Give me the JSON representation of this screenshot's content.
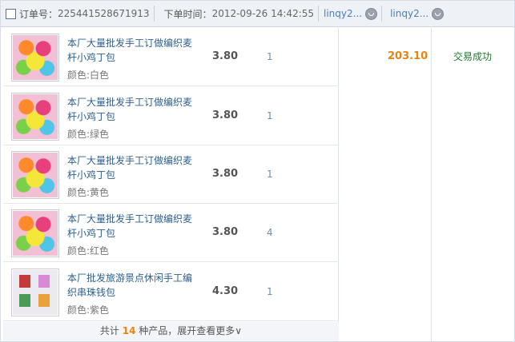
{
  "header": {
    "order_label": "订单号：",
    "order_no": "225441528671913",
    "time_label": "下单时间：",
    "time_value": "2012-09-26 14:42:55",
    "buyer": "linqy2...",
    "seller": "linqy2..."
  },
  "items": [
    {
      "title": "本厂大量批发手工订做编织麦杆小鸡丁包",
      "prop": "颜色:白色",
      "price": "3.80",
      "qty": "1"
    },
    {
      "title": "本厂大量批发手工订做编织麦杆小鸡丁包",
      "prop": "颜色:绿色",
      "price": "3.80",
      "qty": "1"
    },
    {
      "title": "本厂大量批发手工订做编织麦杆小鸡丁包",
      "prop": "颜色:黄色",
      "price": "3.80",
      "qty": "1"
    },
    {
      "title": "本厂大量批发手工订做编织麦杆小鸡丁包",
      "prop": "颜色:红色",
      "price": "3.80",
      "qty": "4"
    },
    {
      "title": "本厂批发旅游景点休闲手工编织串珠钱包",
      "prop": "颜色:紫色",
      "price": "4.30",
      "qty": "1"
    }
  ],
  "more": {
    "prefix": "共计 ",
    "count": "14",
    "suffix": " 种产品，展开查看更多",
    "arrow": "∨"
  },
  "total": "203.10",
  "status": "交易成功",
  "colors": {
    "accent": "#e8840c",
    "link": "#2d5f8f",
    "success": "#1a7c2c"
  }
}
